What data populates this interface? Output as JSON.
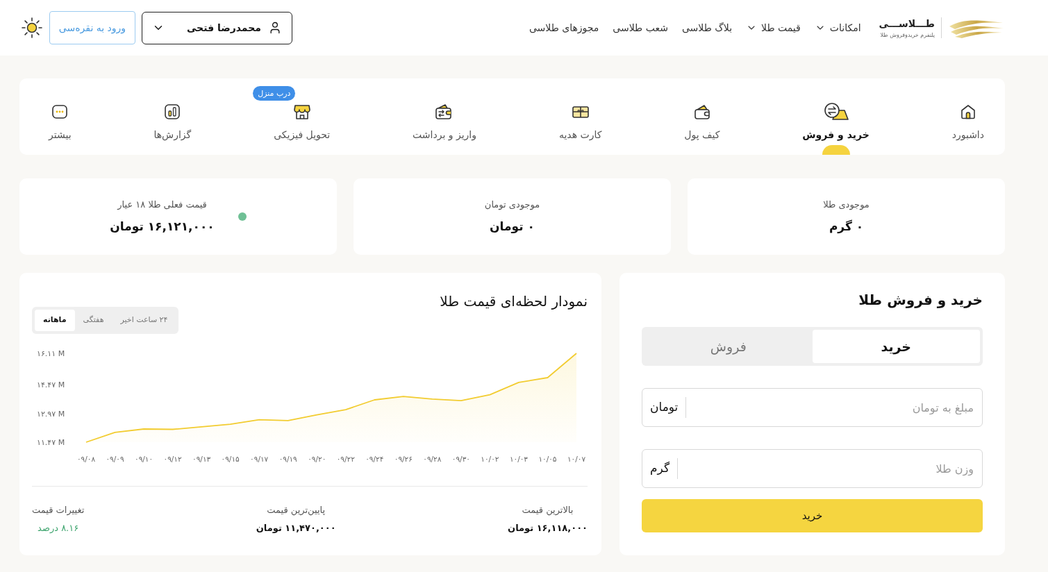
{
  "header": {
    "brand": {
      "name": "طـــلاســـی",
      "tagline": "پلتفرم خریدوفروش طلا"
    },
    "nav": [
      {
        "label": "امکانات",
        "dropdown": true
      },
      {
        "label": "قیمت طلا",
        "dropdown": true
      },
      {
        "label": "بلاگ طلاسی",
        "dropdown": false
      },
      {
        "label": "شعب طلاسی",
        "dropdown": false
      },
      {
        "label": "مجوزهای طلاسی",
        "dropdown": false
      }
    ],
    "user_menu": {
      "name": "محمدرضا فتحی"
    },
    "silver_login": {
      "label": "ورود به نقره‌سی"
    }
  },
  "tabs": [
    {
      "label": "داشبورد",
      "selected": false
    },
    {
      "label": "خرید و فروش",
      "selected": true
    },
    {
      "label": "کیف پول",
      "selected": false
    },
    {
      "label": "کارت هدیه",
      "selected": false
    },
    {
      "label": "واریز و برداشت",
      "selected": false
    },
    {
      "label": "تحویل فیزیکی",
      "selected": false,
      "badge": "درب منزل"
    },
    {
      "label": "گزارش‌ها",
      "selected": false
    },
    {
      "label": "بیشتر",
      "selected": false
    }
  ],
  "balances": [
    {
      "label": "موجودی طلا",
      "value": "۰ گرم",
      "live": false
    },
    {
      "label": "موجودی تومان",
      "value": "۰ تومان",
      "live": false
    },
    {
      "label": "قیمت فعلی طلا ۱۸ عیار",
      "value": "۱۶,۱۲۱,۰۰۰ تومان",
      "live": true
    }
  ],
  "trade": {
    "title": "خرید و فروش طلا",
    "modes": [
      {
        "label": "خرید",
        "selected": true
      },
      {
        "label": "فروش",
        "selected": false
      }
    ],
    "fields": [
      {
        "placeholder": "مبلغ به تومان",
        "unit": "تومان"
      },
      {
        "placeholder": "وزن طلا",
        "unit": "گرم"
      }
    ],
    "submit": "خرید"
  },
  "price_chart": {
    "title": "نمودار لحظه‌ای قیمت طلا",
    "periods": [
      {
        "label": "۲۴ ساعت اخیر",
        "selected": false
      },
      {
        "label": "هفتگی",
        "selected": false
      },
      {
        "label": "ماهانه",
        "selected": true
      }
    ],
    "chart_data": {
      "type": "area",
      "categories": [
        "۰۹/۰۸",
        "۰۹/۰۹",
        "۰۹/۱۰",
        "۰۹/۱۲",
        "۰۹/۱۳",
        "۰۹/۱۵",
        "۰۹/۱۷",
        "۰۹/۱۹",
        "۰۹/۲۰",
        "۰۹/۲۲",
        "۰۹/۲۴",
        "۰۹/۲۶",
        "۰۹/۲۸",
        "۰۹/۳۰",
        "۱۰/۰۲",
        "۱۰/۰۳",
        "۱۰/۰۵",
        "۱۰/۰۷"
      ],
      "series": [
        {
          "color": "#f2cc30",
          "values": [
            11.47,
            11.98,
            12.16,
            12.14,
            12.27,
            12.41,
            12.64,
            12.6,
            12.9,
            13.17,
            13.68,
            13.86,
            13.72,
            13.64,
            13.95,
            14.59,
            14.84,
            16.11
          ]
        }
      ],
      "ylim": [
        11.47,
        16.11
      ],
      "yticks": [
        {
          "value": 11.47,
          "label": "۱۱.۴۷ M"
        },
        {
          "value": 12.97,
          "label": "۱۲.۹۷ M"
        },
        {
          "value": 14.47,
          "label": "۱۴.۴۷ M"
        },
        {
          "value": 16.11,
          "label": "۱۶.۱۱ M"
        }
      ]
    },
    "summary": [
      {
        "label": "بالاترین قیمت",
        "value": "۱۶,۱۱۸,۰۰۰ تومان",
        "kind": "price"
      },
      {
        "label": "پایین‌ترین قیمت",
        "value": "۱۱,۴۷۰,۰۰۰ تومان",
        "kind": "price"
      },
      {
        "label": "تغییرات قیمت",
        "value": "۸.۱۶ درصد",
        "kind": "change"
      }
    ]
  }
}
